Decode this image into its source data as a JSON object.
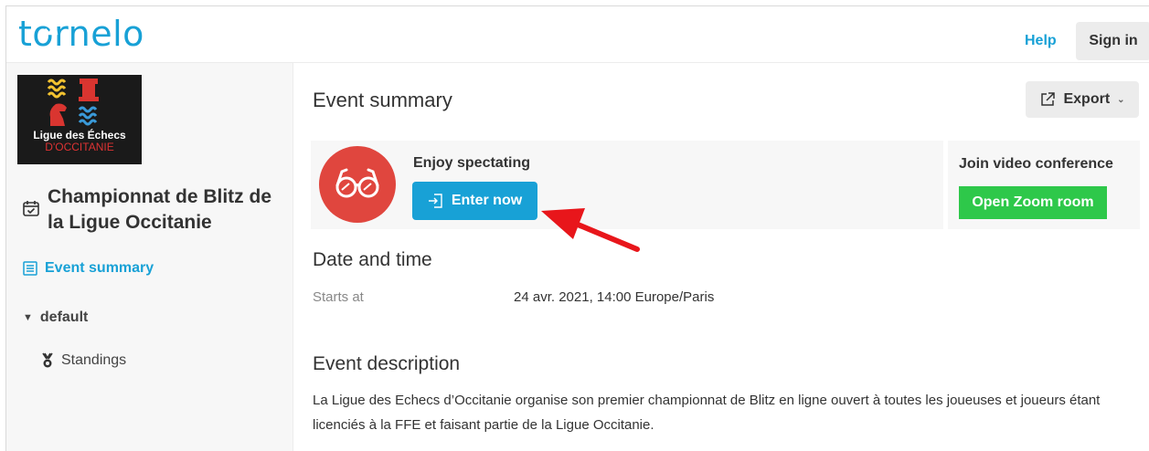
{
  "header": {
    "logo_text": "tornelo",
    "help_label": "Help",
    "signin_label": "Sign in"
  },
  "sidebar": {
    "org_logo_line1": "Ligue des Échecs",
    "org_logo_line2": "D'OCCITANIE",
    "event_title": "Championnat de Blitz de la Ligue Occitanie",
    "nav": {
      "event_summary": "Event summary",
      "group": "default",
      "standings": "Standings"
    }
  },
  "main": {
    "title": "Event summary",
    "export_label": "Export",
    "spectate": {
      "label": "Enjoy spectating",
      "button": "Enter now"
    },
    "video": {
      "label": "Join video conference",
      "button": "Open Zoom room"
    },
    "datetime": {
      "heading": "Date and time",
      "starts_label": "Starts at",
      "starts_value": "24 avr. 2021, 14:00 Europe/Paris"
    },
    "description": {
      "heading": "Event description",
      "text": "La Ligue des Echecs d’Occitanie organise son premier championnat de Blitz en ligne ouvert à toutes les joueuses et joueurs étant licenciés à la FFE et faisant partie de la Ligue Occitanie."
    }
  },
  "colors": {
    "brand": "#18a1d6",
    "spectate_circle": "#e0463e",
    "zoom_green": "#2ec84a",
    "annotation_arrow": "#e8161b"
  }
}
